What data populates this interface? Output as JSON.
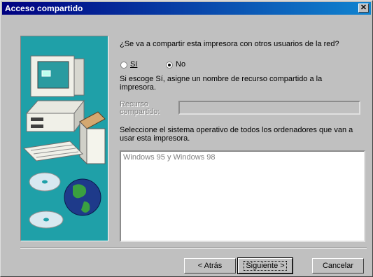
{
  "window": {
    "title": "Acceso compartido",
    "close_glyph": "✕"
  },
  "question": "¿Se va a compartir esta impresora con otros usuarios de la red?",
  "options": {
    "yes": "Sí",
    "no": "No",
    "selected": "no"
  },
  "hint": [
    "Si escoge Sí, asigne un nombre de recurso compartido a la",
    "impresora."
  ],
  "share_name": {
    "label_line1": "Recurso",
    "label_line2": "compartido:",
    "value": ""
  },
  "os_prompt": [
    "Seleccione el sistema operativo de todos los ordenadores que van a",
    "usar esta impresora."
  ],
  "os_list": [
    "Windows 95 y Windows 98"
  ],
  "buttons": {
    "back": "< Atrás",
    "next": "Siguiente >",
    "cancel": "Cancelar"
  }
}
